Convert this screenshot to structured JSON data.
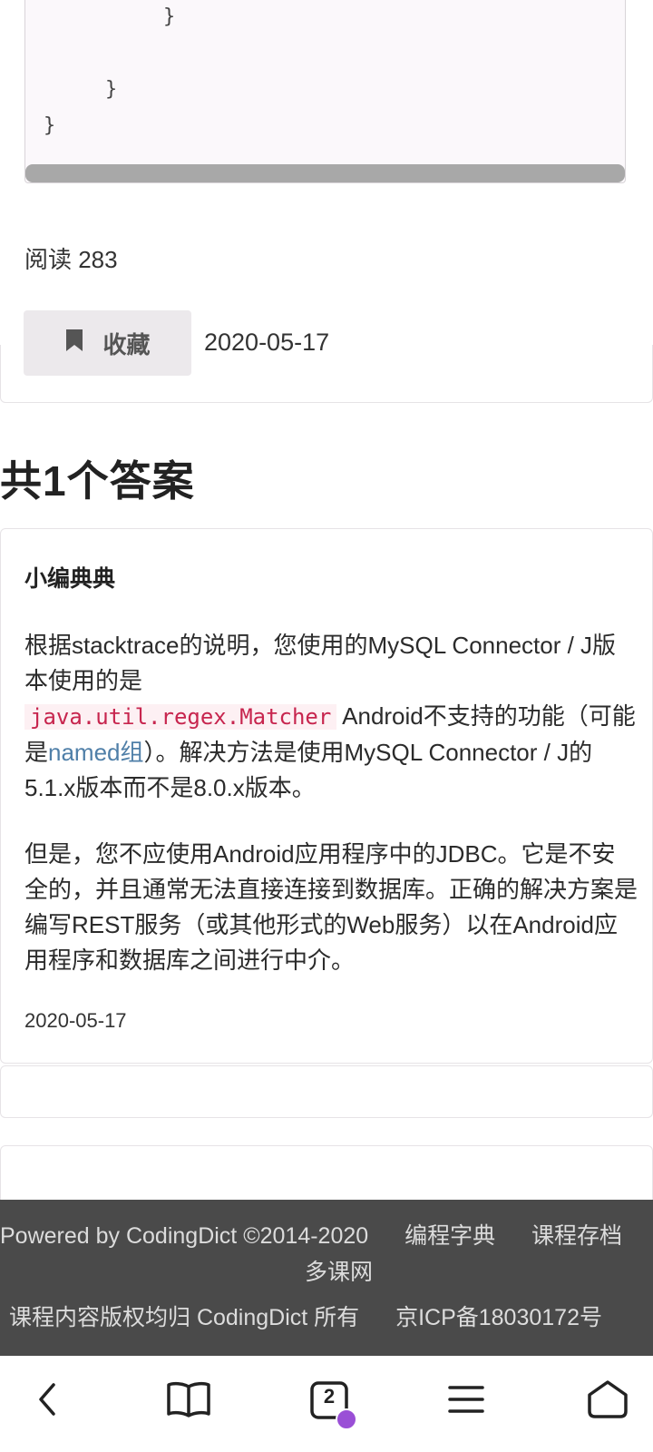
{
  "code": {
    "lines": [
      "}",
      "}",
      "}"
    ]
  },
  "article": {
    "reads": "阅读 283",
    "favorite_label": "收藏",
    "date": "2020-05-17"
  },
  "answers": {
    "title": "共1个答案",
    "items": [
      {
        "author": "小编典典",
        "p1_a": "根据stacktrace的说明，您使用的MySQL Connector / J版本使用的是",
        "p1_code": "java.util.regex.Matcher",
        "p1_b": "Android不支持的功能（可能是",
        "p1_link": "named组",
        "p1_c": "）。解决方法是使用MySQL Connector / J的5.1.x版本而不是8.0.x版本。",
        "p2": "但是，您不应使用Android应用程序中的JDBC。它是不安全的，并且通常无法直接连接到数据库。正确的解决方案是编写REST服务（或其他形式的Web服务）以在Android应用程序和数据库之间进行中介。",
        "date": "2020-05-17"
      }
    ]
  },
  "footer": {
    "powered": "Powered by CodingDict ©2014-2020",
    "link1": "编程字典",
    "link2": "课程存档",
    "link3": "多课网",
    "copyright": "课程内容版权均归 CodingDict 所有",
    "icp": "京ICP备18030172号"
  },
  "nav": {
    "tab_count": "2"
  }
}
